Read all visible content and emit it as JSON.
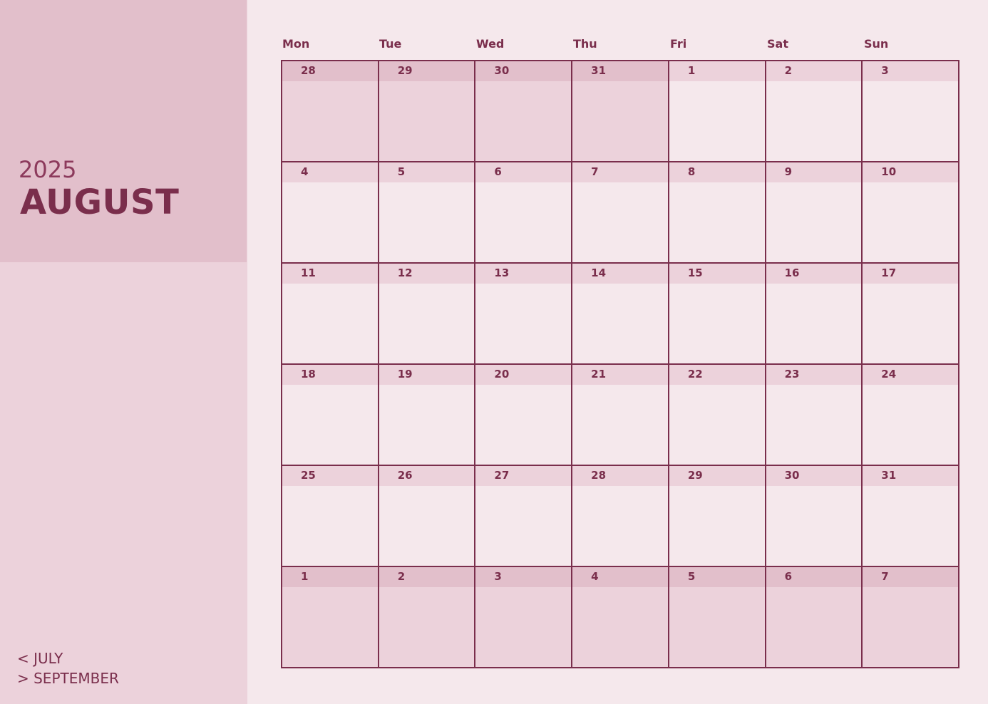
{
  "calendar": {
    "year": "2025",
    "month": "AUGUST",
    "prev_month": "< JULY",
    "next_month": "> SEPTEMBER",
    "weekdays": [
      "Mon",
      "Tue",
      "Wed",
      "Thu",
      "Fri",
      "Sat",
      "Sun"
    ],
    "weeks": [
      [
        {
          "day": "28",
          "in_month": false
        },
        {
          "day": "29",
          "in_month": false
        },
        {
          "day": "30",
          "in_month": false
        },
        {
          "day": "31",
          "in_month": false
        },
        {
          "day": "1",
          "in_month": true
        },
        {
          "day": "2",
          "in_month": true
        },
        {
          "day": "3",
          "in_month": true
        }
      ],
      [
        {
          "day": "4",
          "in_month": true
        },
        {
          "day": "5",
          "in_month": true
        },
        {
          "day": "6",
          "in_month": true
        },
        {
          "day": "7",
          "in_month": true
        },
        {
          "day": "8",
          "in_month": true
        },
        {
          "day": "9",
          "in_month": true
        },
        {
          "day": "10",
          "in_month": true
        }
      ],
      [
        {
          "day": "11",
          "in_month": true
        },
        {
          "day": "12",
          "in_month": true
        },
        {
          "day": "13",
          "in_month": true
        },
        {
          "day": "14",
          "in_month": true
        },
        {
          "day": "15",
          "in_month": true
        },
        {
          "day": "16",
          "in_month": true
        },
        {
          "day": "17",
          "in_month": true
        }
      ],
      [
        {
          "day": "18",
          "in_month": true
        },
        {
          "day": "19",
          "in_month": true
        },
        {
          "day": "20",
          "in_month": true
        },
        {
          "day": "21",
          "in_month": true
        },
        {
          "day": "22",
          "in_month": true
        },
        {
          "day": "23",
          "in_month": true
        },
        {
          "day": "24",
          "in_month": true
        }
      ],
      [
        {
          "day": "25",
          "in_month": true
        },
        {
          "day": "26",
          "in_month": true
        },
        {
          "day": "27",
          "in_month": true
        },
        {
          "day": "28",
          "in_month": true
        },
        {
          "day": "29",
          "in_month": true
        },
        {
          "day": "30",
          "in_month": true
        },
        {
          "day": "31",
          "in_month": true
        }
      ],
      [
        {
          "day": "1",
          "in_month": false
        },
        {
          "day": "2",
          "in_month": false
        },
        {
          "day": "3",
          "in_month": false
        },
        {
          "day": "4",
          "in_month": false
        },
        {
          "day": "5",
          "in_month": false
        },
        {
          "day": "6",
          "in_month": false
        },
        {
          "day": "7",
          "in_month": false
        }
      ]
    ]
  },
  "colors": {
    "accent": "#7a2e4c",
    "background": "#f5e8ec",
    "panel": "#ecd2db",
    "panel_dark": "#e2bfcb"
  }
}
